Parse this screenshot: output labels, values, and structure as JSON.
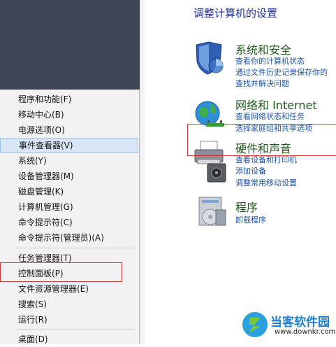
{
  "menu": {
    "items": [
      {
        "label": "程序和功能(F)"
      },
      {
        "label": "移动中心(B)"
      },
      {
        "label": "电源选项(O)"
      },
      {
        "label": "事件查看器(V)"
      },
      {
        "label": "系统(Y)"
      },
      {
        "label": "设备管理器(M)"
      },
      {
        "label": "磁盘管理(K)"
      },
      {
        "label": "计算机管理(G)"
      },
      {
        "label": "命令提示符(C)"
      },
      {
        "label": "命令提示符(管理员)(A)"
      },
      {
        "label": "任务管理器(T)"
      },
      {
        "label": "控制面板(P)"
      },
      {
        "label": "文件资源管理器(E)"
      },
      {
        "label": "搜索(S)"
      },
      {
        "label": "运行(R)"
      },
      {
        "label": "桌面(D)"
      }
    ],
    "highlighted": "事件查看器(V)"
  },
  "control_panel": {
    "title": "调整计算机的设置",
    "categories": [
      {
        "heading": "系统和安全",
        "links": [
          "查看你的计算机状态",
          "通过文件历史记录保存你的",
          "查找并解决问题"
        ]
      },
      {
        "heading": "网络和 Internet",
        "links": [
          "查看网络状态和任务",
          "选择家庭组和共享选项"
        ]
      },
      {
        "heading": "硬件和声音",
        "links": [
          "查看设备和打印机",
          "添加设备",
          "调整常用移动设置"
        ]
      },
      {
        "heading": "程序",
        "links": [
          "卸载程序"
        ]
      }
    ]
  },
  "watermark": {
    "name": "当客软件园",
    "url": "www.downkr.com"
  },
  "colors": {
    "heading_green": "#1e5a1e",
    "link_blue": "#1d54a6",
    "title_blue": "#1e3287",
    "highlight_red": "#d83a3a",
    "menu_highlight": "#d8e6f7"
  }
}
